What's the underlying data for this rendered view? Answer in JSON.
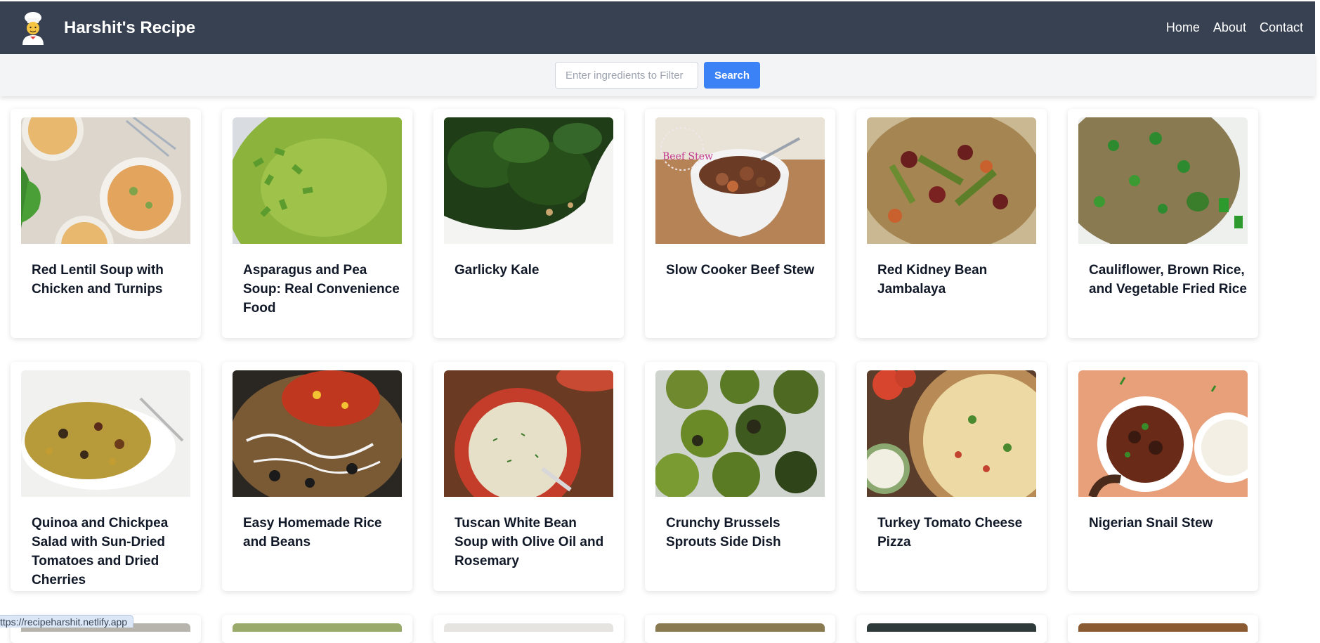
{
  "brand": {
    "title": "Harshit's Recipe",
    "logo_icon": "chef-icon"
  },
  "nav": {
    "items": [
      "Home",
      "About",
      "Contact"
    ]
  },
  "search": {
    "placeholder": "Enter ingredients to Filter",
    "value": "",
    "button_label": "Search"
  },
  "recipes": [
    {
      "title": "Red Lentil Soup with Chicken and Turnips",
      "image": "lentil-soup-image"
    },
    {
      "title": "Asparagus and Pea Soup: Real Convenience Food",
      "image": "pea-soup-image"
    },
    {
      "title": "Garlicky Kale",
      "image": "kale-image"
    },
    {
      "title": "Slow Cooker Beef Stew",
      "image": "beef-stew-image"
    },
    {
      "title": "Red Kidney Bean Jambalaya",
      "image": "jambalaya-image"
    },
    {
      "title": "Cauliflower, Brown Rice, and Vegetable Fried Rice",
      "image": "fried-rice-image"
    },
    {
      "title": "Quinoa and Chickpea Salad with Sun-Dried Tomatoes and Dried Cherries",
      "image": "quinoa-salad-image"
    },
    {
      "title": "Easy Homemade Rice and Beans",
      "image": "rice-beans-image"
    },
    {
      "title": "Tuscan White Bean Soup with Olive Oil and Rosemary",
      "image": "white-bean-soup-image"
    },
    {
      "title": "Crunchy Brussels Sprouts Side Dish",
      "image": "brussels-sprouts-image"
    },
    {
      "title": "Turkey Tomato Cheese Pizza",
      "image": "pizza-image"
    },
    {
      "title": "Nigerian Snail Stew",
      "image": "snail-stew-image"
    }
  ],
  "status_url": "ttps://recipeharshit.netlify.app"
}
